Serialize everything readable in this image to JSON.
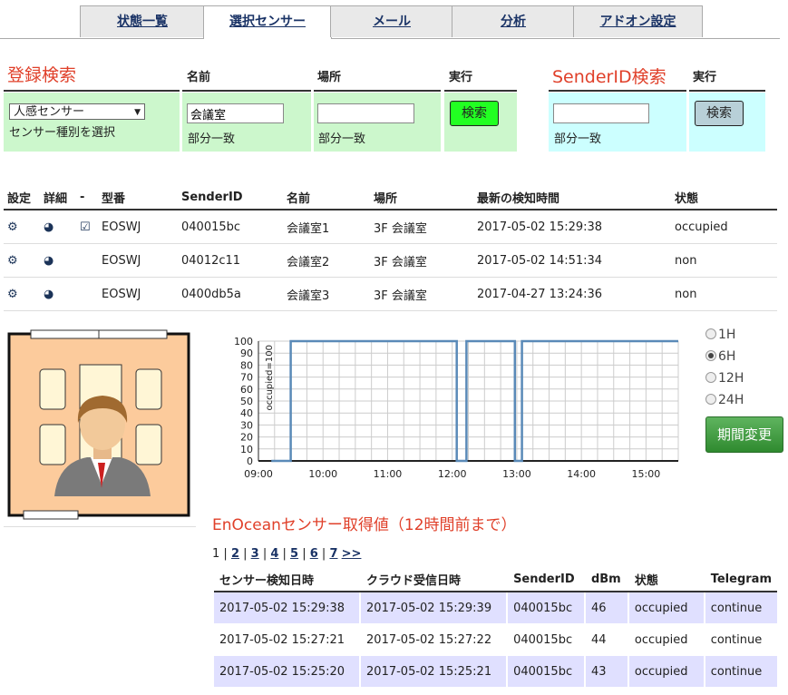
{
  "tabs": [
    {
      "label": "状態一覧",
      "active": false
    },
    {
      "label": "選択センサー",
      "active": true
    },
    {
      "label": "メール",
      "active": false
    },
    {
      "label": "分析",
      "active": false
    },
    {
      "label": "アドオン設定",
      "active": false
    }
  ],
  "search": {
    "title": "登録検索",
    "col_name": "名前",
    "col_place": "場所",
    "col_exec": "実行",
    "sensor_type_value": "人感センサー",
    "sensor_type_hint": "センサー種別を選択",
    "name_value": "会議室",
    "name_hint": "部分一致",
    "place_value": "",
    "place_hint": "部分一致",
    "search_label": "検索"
  },
  "sender_search": {
    "title": "SenderID検索",
    "col_exec": "実行",
    "value": "",
    "hint": "部分一致",
    "search_label": "検索"
  },
  "sensor_table": {
    "headers": [
      "設定",
      "詳細",
      "-",
      "型番",
      "SenderID",
      "名前",
      "場所",
      "最新の検知時間",
      "状態"
    ],
    "rows": [
      {
        "model": "EOSWJ",
        "sender": "040015bc",
        "name": "会議室1",
        "place": "3F 会議室",
        "time": "2017-05-02 15:29:38",
        "state": "occupied",
        "checked": true
      },
      {
        "model": "EOSWJ",
        "sender": "04012c11",
        "name": "会議室2",
        "place": "3F 会議室",
        "time": "2017-05-02 14:51:34",
        "state": "non",
        "checked": false
      },
      {
        "model": "EOSWJ",
        "sender": "0400db5a",
        "name": "会議室3",
        "place": "3F 会議室",
        "time": "2017-04-27 13:24:36",
        "state": "non",
        "checked": false
      }
    ]
  },
  "chart_data": {
    "type": "line",
    "ylabel": "occupied=100",
    "yticks": [
      0,
      10,
      20,
      30,
      40,
      50,
      60,
      70,
      80,
      90,
      100
    ],
    "xticks": [
      "09:00",
      "10:00",
      "11:00",
      "12:00",
      "13:00",
      "14:00",
      "15:00"
    ],
    "xlim": [
      9.0,
      15.5
    ],
    "ylim": [
      0,
      100
    ],
    "grid": true,
    "series": [
      {
        "color": "#5a8ab8",
        "points": [
          [
            9.2,
            0
          ],
          [
            9.5,
            0
          ],
          [
            9.5,
            100
          ],
          [
            12.07,
            100
          ],
          [
            12.07,
            0
          ],
          [
            12.22,
            0
          ],
          [
            12.22,
            100
          ],
          [
            12.97,
            100
          ],
          [
            12.97,
            0
          ],
          [
            13.08,
            0
          ],
          [
            13.08,
            100
          ],
          [
            15.5,
            100
          ]
        ]
      }
    ]
  },
  "period": {
    "options": [
      "1H",
      "6H",
      "12H",
      "24H"
    ],
    "selected": "6H",
    "button_label": "期間変更"
  },
  "log": {
    "title": "EnOceanセンサー取得値（12時間前まで）",
    "pager_current": "1",
    "pages": [
      "2",
      "3",
      "4",
      "5",
      "6",
      "7",
      ">>"
    ],
    "headers": [
      "センサー検知日時",
      "クラウド受信日時",
      "SenderID",
      "dBm",
      "状態",
      "Telegram"
    ],
    "rows": [
      [
        "2017-05-02 15:29:38",
        "2017-05-02 15:29:39",
        "040015bc",
        "46",
        "occupied",
        "continue"
      ],
      [
        "2017-05-02 15:27:21",
        "2017-05-02 15:27:22",
        "040015bc",
        "44",
        "occupied",
        "continue"
      ],
      [
        "2017-05-02 15:25:20",
        "2017-05-02 15:25:21",
        "040015bc",
        "43",
        "occupied",
        "continue"
      ]
    ]
  }
}
